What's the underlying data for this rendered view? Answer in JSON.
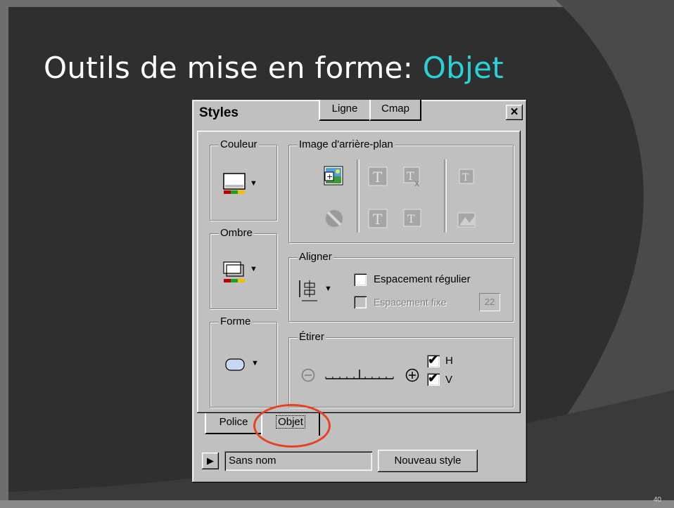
{
  "slide": {
    "title_prefix": "Outils de mise en forme: ",
    "title_accent": "Objet",
    "page_number": "40",
    "accent_color": "#2ad2d8"
  },
  "window": {
    "title": "Styles",
    "close_glyph": "×"
  },
  "groups": {
    "couleur": "Couleur",
    "ombre": "Ombre",
    "forme": "Forme",
    "image": "Image d'arrière-plan",
    "aligner": "Aligner",
    "etirer": "Étirer"
  },
  "aligner": {
    "espacement_regulier": "Espacement régulier",
    "espacement_fixe": "Espacement fixe",
    "fixe_value": "22"
  },
  "etirer": {
    "h_label": "H",
    "v_label": "V",
    "h_checked": true,
    "v_checked": true
  },
  "tabs": [
    {
      "label": "Police"
    },
    {
      "label": "Objet",
      "active": true
    },
    {
      "label": "Ligne"
    },
    {
      "label": "Cmap"
    }
  ],
  "bottom": {
    "style_name": "Sans nom",
    "new_style_button": "Nouveau style"
  },
  "highlight_color": "#e8411e",
  "icons": [
    "close-icon",
    "color-swatch-icon",
    "shadow-swatch-icon",
    "shape-icon",
    "background-image-icon",
    "tile-icon",
    "position-icon",
    "stretch-icon",
    "no-image-icon",
    "align-icon",
    "zoom-out-icon",
    "zoom-in-icon",
    "play-arrow-icon"
  ]
}
